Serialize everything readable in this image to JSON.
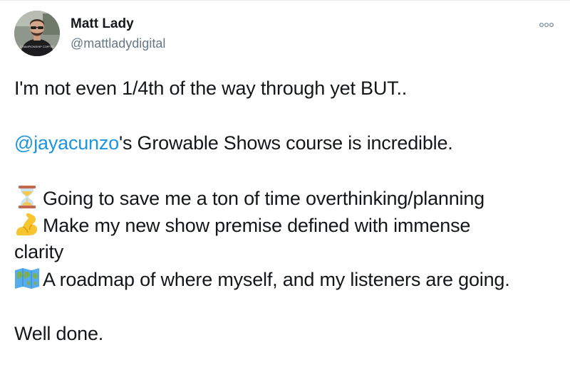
{
  "author": {
    "name": "Matt Lady",
    "handle": "@mattladydigital",
    "avatar_shirt_text": "CHAMPIONSHIP COFFEE"
  },
  "menu_icon": "more-dots-icon",
  "tweet": {
    "line1": "I'm not even 1/4th of the way through yet BUT..",
    "mention": "@jayacunzo",
    "line2_rest": "'s Growable Shows course is incredible.",
    "bullets": [
      {
        "icon": "hourglass-icon",
        "text": "Going to save me a ton of time overthinking/planning"
      },
      {
        "icon": "flexed-biceps-icon",
        "text": "Make my new show premise defined with immense",
        "text_cont": "clarity"
      },
      {
        "icon": "world-map-icon",
        "text": "A roadmap of where myself, and my listeners are going."
      }
    ],
    "closing": "Well done."
  },
  "colors": {
    "mention": "#1b95e0",
    "text": "#14171a",
    "handle": "#657786"
  }
}
